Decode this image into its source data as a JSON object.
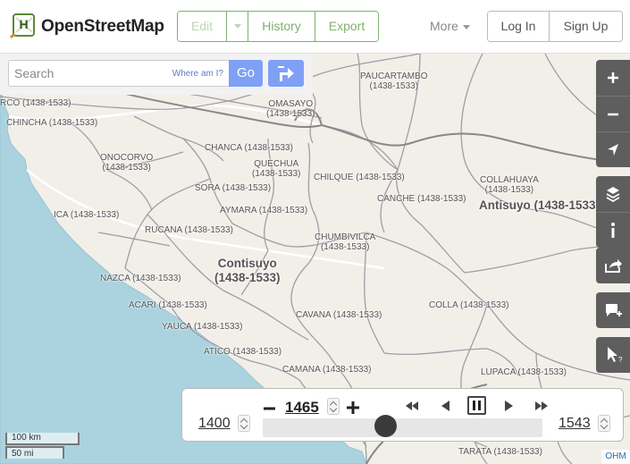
{
  "header": {
    "brand": "OpenStreetMap",
    "edit": "Edit",
    "history": "History",
    "export": "Export",
    "more": "More",
    "login": "Log In",
    "signup": "Sign Up"
  },
  "search": {
    "placeholder": "Search",
    "where_am_i": "Where am I?",
    "go": "Go"
  },
  "map": {
    "labels": [
      {
        "text": "PAUCARTAMBO\n(1438-1533)"
      },
      {
        "text": "OMASAYO\n(1438-1533)"
      },
      {
        "text": "RCO (1438-1533)"
      },
      {
        "text": "CHINCHA (1438-1533)"
      },
      {
        "text": "CHANCA (1438-1533)"
      },
      {
        "text": "ONOCORVO\n(1438-1533)"
      },
      {
        "text": "QUECHUA\n(1438-1533)"
      },
      {
        "text": "CHILQUE (1438-1533)"
      },
      {
        "text": "COLLAHUAYA\n(1438-1533)"
      },
      {
        "text": "SORA (1438-1533)"
      },
      {
        "text": "CANCHE (1438-1533)"
      },
      {
        "text": "AYMARA (1438-1533)"
      },
      {
        "text": "ICA (1438-1533)"
      },
      {
        "text": "RUCANA (1438-1533)"
      },
      {
        "text": "CHUMBIVILCA\n(1438-1533)"
      },
      {
        "text": "NAZCA (1438-1533)"
      },
      {
        "text": "COLLA (1438-1533)"
      },
      {
        "text": "ACARI (1438-1533)"
      },
      {
        "text": "CAVANA (1438-1533)"
      },
      {
        "text": "YAUCA (1438-1533)"
      },
      {
        "text": "ATICO (1438-1533)"
      },
      {
        "text": "CAMANA (1438-1533)"
      },
      {
        "text": "LUPACA (1438-1533)"
      },
      {
        "text": "TARATA (1438-1533)"
      }
    ],
    "regions": [
      {
        "text": "Antisuyo (1438-1533)"
      },
      {
        "text": "Contisuyo\n(1438-1533)"
      }
    ]
  },
  "controls": {
    "zoom_in": "zoom-in",
    "zoom_out": "zoom-out",
    "locate": "locate",
    "layers": "layers",
    "info": "info",
    "share": "share",
    "note": "add-note",
    "query": "query"
  },
  "timeslider": {
    "start": "1400",
    "current": "1465",
    "end": "1543",
    "current_fraction": 0.44
  },
  "scale": {
    "km": "100 km",
    "mi": "50 mi"
  },
  "attribution": "OHM",
  "colors": {
    "land": "#f2efe9",
    "water": "#aad3df",
    "border": "#9e9ea6",
    "accent_green": "#7eb26d",
    "button_blue": "#7fa0f5",
    "control_grey": "#5e5e5e"
  }
}
